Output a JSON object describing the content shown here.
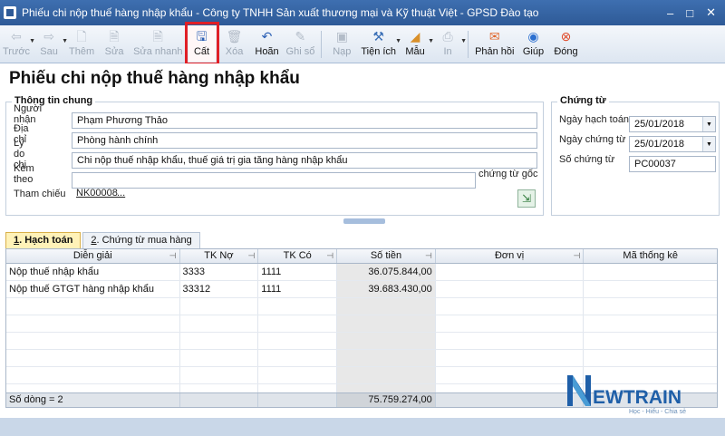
{
  "window": {
    "title": "Phiếu chi nộp thuế hàng nhập khẩu - Công ty TNHH Sản xuất thương mại và Kỹ thuật Việt - GPSD Đào tạo",
    "minimize": "–",
    "maximize": "□",
    "close": "✕"
  },
  "toolbar": {
    "prev": "Trước",
    "next": "Sau",
    "add": "Thêm",
    "edit": "Sửa",
    "quick_edit": "Sửa nhanh",
    "save": "Cất",
    "delete": "Xóa",
    "undo": "Hoãn",
    "post": "Ghi sổ",
    "load": "Nạp",
    "utility": "Tiện ích",
    "template": "Mẫu",
    "print": "In",
    "feedback": "Phản hồi",
    "help": "Giúp",
    "close": "Đóng"
  },
  "page_title": "Phiếu chi nộp thuế hàng nhập khẩu",
  "general": {
    "title": "Thông tin chung",
    "recipient_label": "Người nhận",
    "recipient": "Phạm Phương Thảo",
    "address_label": "Địa chỉ",
    "address": "Phòng hành chính",
    "reason_label": "Lý do chi",
    "reason": "Chi nộp thuế nhập khẩu, thuế giá trị gia tăng hàng nhập khẩu",
    "attach_label": "Kèm theo",
    "attach": "",
    "attach_suffix": "chứng từ gốc",
    "ref_label": "Tham chiếu",
    "ref": "NK00008",
    "ref_more": "..."
  },
  "voucher": {
    "title": "Chứng từ",
    "post_date_label": "Ngày hạch toán",
    "post_date": "25/01/2018",
    "doc_date_label": "Ngày chứng từ",
    "doc_date": "25/01/2018",
    "doc_no_label": "Số chứng từ",
    "doc_no": "PC00037"
  },
  "tabs": [
    {
      "num": "1",
      "label": ". Hạch toán"
    },
    {
      "num": "2",
      "label": ". Chứng từ mua hàng"
    }
  ],
  "grid": {
    "columns": [
      "Diễn giải",
      "TK Nợ",
      "TK Có",
      "Số tiền",
      "Đơn vị",
      "Mã thống kê"
    ],
    "rows": [
      [
        "Nộp thuế nhập khẩu",
        "3333",
        "1111",
        "36.075.844,00",
        "",
        ""
      ],
      [
        "Nộp thuế GTGT hàng nhập khẩu",
        "33312",
        "1111",
        "39.683.430,00",
        "",
        ""
      ]
    ],
    "footer_count": "Số dòng = 2",
    "footer_total": "75.759.274,00"
  },
  "logo": {
    "text_n": "N",
    "text_rest": "EWTRAIN",
    "tagline": "Học - Hiểu - Chia sẻ"
  },
  "colors": {
    "accent": "#2e5a97",
    "highlight": "#e01f26"
  }
}
